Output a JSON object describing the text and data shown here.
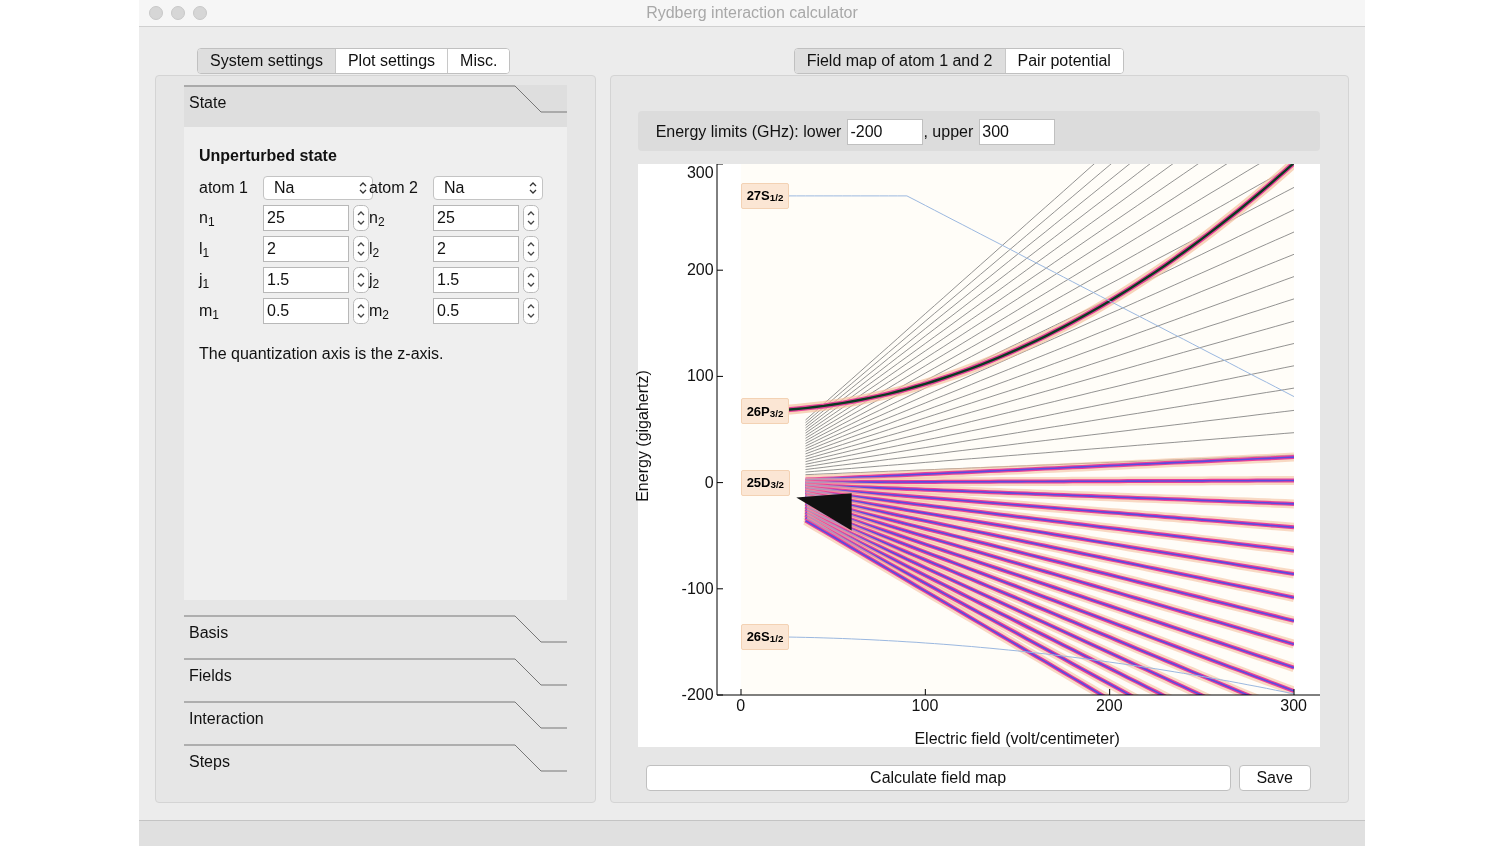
{
  "window": {
    "title": "Rydberg interaction calculator"
  },
  "left_tabs": [
    {
      "label": "System settings",
      "selected": true
    },
    {
      "label": "Plot settings",
      "selected": false
    },
    {
      "label": "Misc.",
      "selected": false
    }
  ],
  "sections": [
    {
      "title": "State",
      "expanded": true,
      "heading": "Unperturbed state",
      "atoms": [
        {
          "label": "atom 1",
          "value": "Na"
        },
        {
          "label": "atom 2",
          "value": "Na"
        }
      ],
      "rows": [
        {
          "label_1": "n$_{1}$",
          "value_1": "25",
          "label_2": "n$_{2}$",
          "value_2": "25"
        },
        {
          "label_1": "l$_{1}$",
          "value_1": "2",
          "label_2": "l$_{2}$",
          "value_2": "2"
        },
        {
          "label_1": "j$_{1}$",
          "value_1": "1.5",
          "label_2": "j$_{2}$",
          "value_2": "1.5"
        },
        {
          "label_1": "m$_{1}$",
          "value_1": "0.5",
          "label_2": "m$_{2}$",
          "value_2": "0.5"
        }
      ],
      "note": "The quantization axis is the z-axis."
    },
    {
      "title": "Basis",
      "expanded": false
    },
    {
      "title": "Fields",
      "expanded": false
    },
    {
      "title": "Interaction",
      "expanded": false
    },
    {
      "title": "Steps",
      "expanded": false
    }
  ],
  "right_tabs": [
    {
      "label": "Field map of atom 1 and 2",
      "selected": true
    },
    {
      "label": "Pair potential",
      "selected": false
    }
  ],
  "energy_limits": {
    "label": "Energy limits (GHz): lower",
    "lower": "-200",
    "upper_label": ", upper",
    "upper": "300"
  },
  "plot": {
    "xlabel": "Electric field (volt/centimeter)",
    "ylabel": "Energy (gigahertz)",
    "xticks": [
      "0",
      "100",
      "200",
      "300"
    ],
    "yticks": [
      "300",
      "200",
      "100",
      "0",
      "-100",
      "-200"
    ],
    "state_labels": [
      "27S$_{1/2}$",
      "26P$_{3/2}$",
      "25D$_{3/2}$",
      "26S$_{1/2}$"
    ]
  },
  "buttons": [
    {
      "label": "Calculate field map"
    },
    {
      "label": "Save"
    }
  ]
}
